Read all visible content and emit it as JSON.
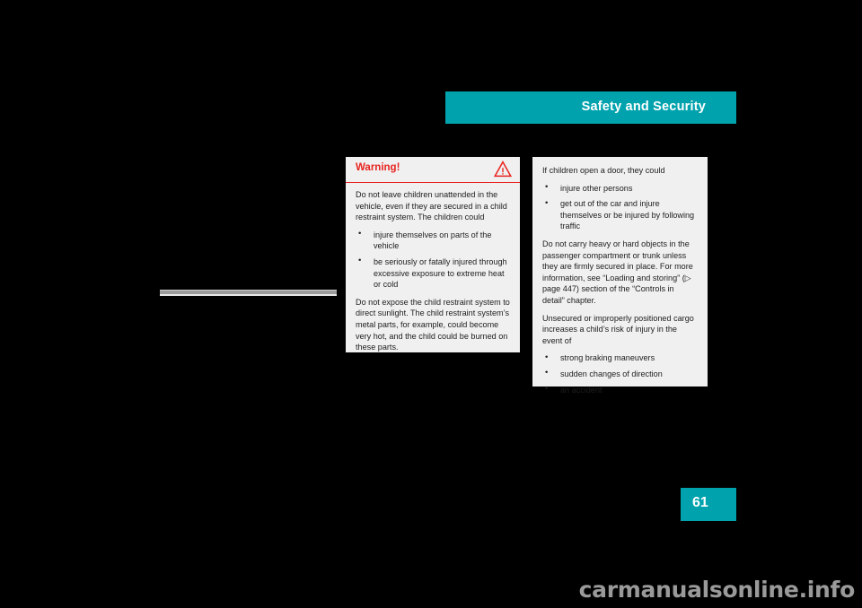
{
  "header": {
    "title": "Safety and Security",
    "accent_color": "#00a2ad"
  },
  "warning_box": {
    "title": "Warning!",
    "icon": "warning-triangle-icon",
    "accent_color": "#e8231f",
    "background_color": "#f0f0f0",
    "paragraph_1": "Do not leave children unattended in the vehicle, even if they are secured in a child restraint system. The children could",
    "bullets": [
      "injure themselves on parts of the vehicle",
      "be seriously or fatally injured through excessive exposure to extreme heat or cold"
    ],
    "paragraph_2": "Do not expose the child restraint system to direct sunlight. The child restraint system’s metal parts, for example, could become very hot, and the child could be burned on these parts."
  },
  "right_panel": {
    "background_color": "#f0f0f0",
    "paragraph_1": "If children open a door, they could",
    "bullets_1": [
      "injure other persons",
      "get out of the car and injure themselves or be injured by following traffic"
    ],
    "paragraph_2": "Do not carry heavy or hard objects in the passenger compartment or trunk unless they are firmly secured in place. For more information, see “Loading and storing” (▷ page 447) section of the “Controls in detail” chapter.",
    "paragraph_3": "Unsecured or improperly positioned cargo increases a child’s risk of injury in the event of",
    "bullets_2": [
      "strong braking maneuvers",
      "sudden changes of direction",
      "an accident"
    ]
  },
  "page_number": {
    "value": "61"
  },
  "watermark": {
    "text": "carmanualsonline.info"
  }
}
